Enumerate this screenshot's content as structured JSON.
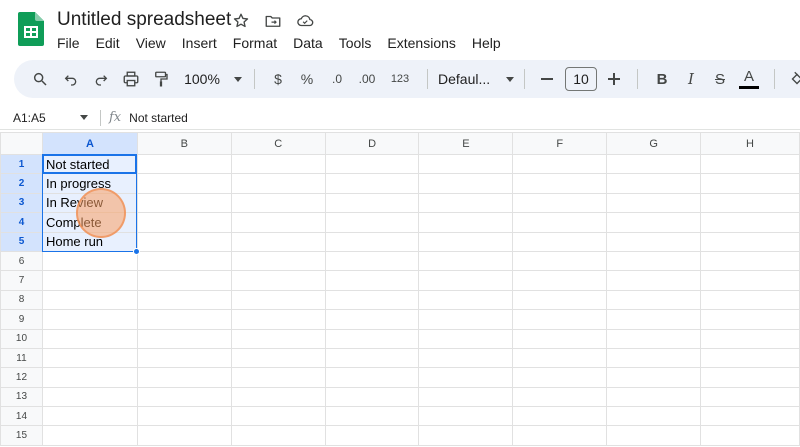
{
  "app": {
    "doc_title": "Untitled spreadsheet",
    "brand_color": "#0f9d58"
  },
  "menu": [
    "File",
    "Edit",
    "View",
    "Insert",
    "Format",
    "Data",
    "Tools",
    "Extensions",
    "Help"
  ],
  "toolbar": {
    "zoom": "100%",
    "currency_label": "$",
    "percent_label": "%",
    "decrease_decimal_label": ".0",
    "increase_decimal_label": ".00",
    "number_format_label": "123",
    "font_family": "Defaul...",
    "font_size": "10",
    "bold_label": "B",
    "italic_label": "I",
    "strike_label": "S",
    "text_color_label": "A"
  },
  "formula_bar": {
    "name_box": "A1:A5",
    "fx_label": "fx",
    "content": "Not started"
  },
  "grid": {
    "columns": [
      "A",
      "B",
      "C",
      "D",
      "E",
      "F",
      "G",
      "H"
    ],
    "rows": [
      "1",
      "2",
      "3",
      "4",
      "5",
      "6",
      "7",
      "8",
      "9",
      "10",
      "11",
      "12",
      "13",
      "14",
      "15"
    ],
    "cells_A": [
      "Not started",
      "In progress",
      "In Review",
      "Complete",
      "Home run"
    ]
  },
  "selection": {
    "range": "A1:A5",
    "accent": "#1a73e8"
  }
}
